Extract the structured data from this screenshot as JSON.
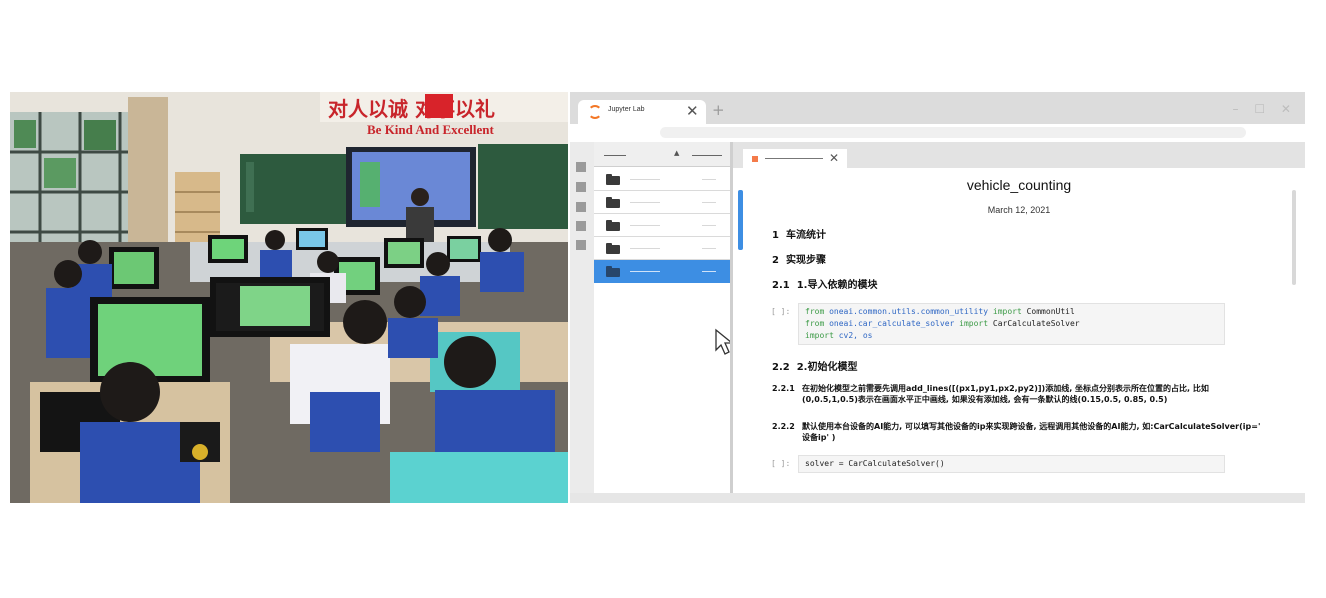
{
  "browser": {
    "tab_title": "Jupyter Lab",
    "tab_close_glyph": "✕",
    "new_tab_glyph": "+",
    "window_controls": "– ☐ ✕"
  },
  "filebrowser": {
    "sort_glyph": "▲",
    "rows": [
      {
        "icon": "folder-icon",
        "selected": false
      },
      {
        "icon": "folder-icon",
        "selected": false
      },
      {
        "icon": "folder-icon",
        "selected": false
      },
      {
        "icon": "folder-icon",
        "selected": false
      },
      {
        "icon": "folder-icon",
        "selected": true
      }
    ]
  },
  "notebook": {
    "tab_close_glyph": "✕",
    "title": "vehicle_counting",
    "date": "March 12, 2021",
    "headings": [
      {
        "num": "1",
        "text": "车流统计"
      },
      {
        "num": "2",
        "text": "实现步骤"
      },
      {
        "num": "2.1",
        "text": "1.导入依赖的模块"
      },
      {
        "num": "2.2",
        "text": "2.初始化模型"
      }
    ],
    "cell1": {
      "prompt": "[ ]:",
      "line1": {
        "kw1": "from",
        "mod": "oneai.common.utils.common_utility",
        "kw2": "import",
        "name": "CommonUtil"
      },
      "line2": {
        "kw1": "from",
        "mod": "oneai.car_calculate_solver",
        "kw2": "import",
        "name": "CarCalculateSolver"
      },
      "line3": {
        "kw1": "import",
        "mod": "cv2, os"
      }
    },
    "para1": {
      "num": "2.2.1",
      "text": "在初始化模型之前需要先调用add_lines([(px1,py1,px2,py2)])添加线, 坐标点分别表示所在位置的占比, 比如(0,0.5,1,0.5)表示在画面水平正中画线, 如果没有添加线, 会有一条默认的线(0.15,0.5, 0.85, 0.5)"
    },
    "para2": {
      "num": "2.2.2",
      "text": "默认使用本台设备的AI能力, 可以填写其他设备的ip来实现跨设备, 远程调用其他设备的AI能力, 如:CarCalculateSolver(ip=' 设备ip' )"
    },
    "cell2": {
      "prompt": "[ ]:",
      "code": "solver = CarCalculateSolver()"
    }
  },
  "photo": {
    "banner_text": "对人以诚 对事以礼",
    "slogan": "Be Kind And Excellent",
    "colors": {
      "wall": "#e8e4dc",
      "banner": "#d8232a",
      "board": "#2d5a3e",
      "uniform": "#2d4fb0",
      "desk": "#d9c6a8"
    }
  }
}
